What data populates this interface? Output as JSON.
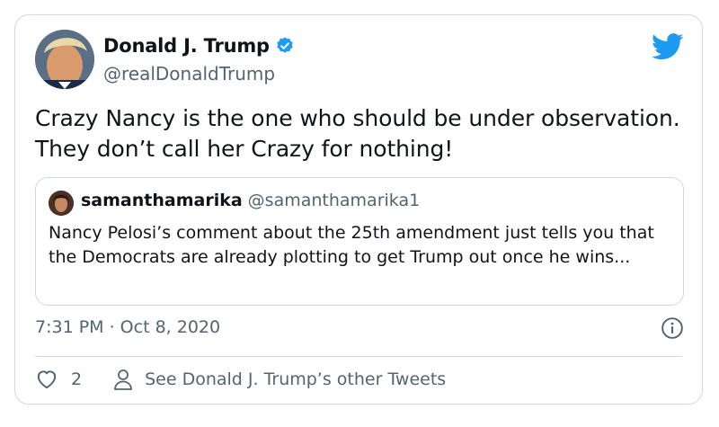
{
  "author": {
    "name": "Donald J. Trump",
    "handle": "@realDonaldTrump"
  },
  "tweet": {
    "text": "Crazy Nancy is the one who should be under observation. They don’t call her Crazy for nothing!",
    "timestamp": "7:31 PM · Oct 8, 2020"
  },
  "quoted": {
    "name": "samanthamarika",
    "handle": "@samanthamarika1",
    "text": "Nancy Pelosi’s comment about the 25th amendment just tells you that the Democrats are already plotting to get Trump out once he wins..."
  },
  "actions": {
    "like_count": "2",
    "see_more": "See Donald J. Trump’s other Tweets"
  },
  "colors": {
    "twitter_blue": "#1d9bf0",
    "secondary_text": "#536471",
    "border": "#cfd9de"
  },
  "icons": [
    "verified-badge-icon",
    "twitter-bird-icon",
    "info-icon",
    "heart-icon",
    "person-icon"
  ]
}
